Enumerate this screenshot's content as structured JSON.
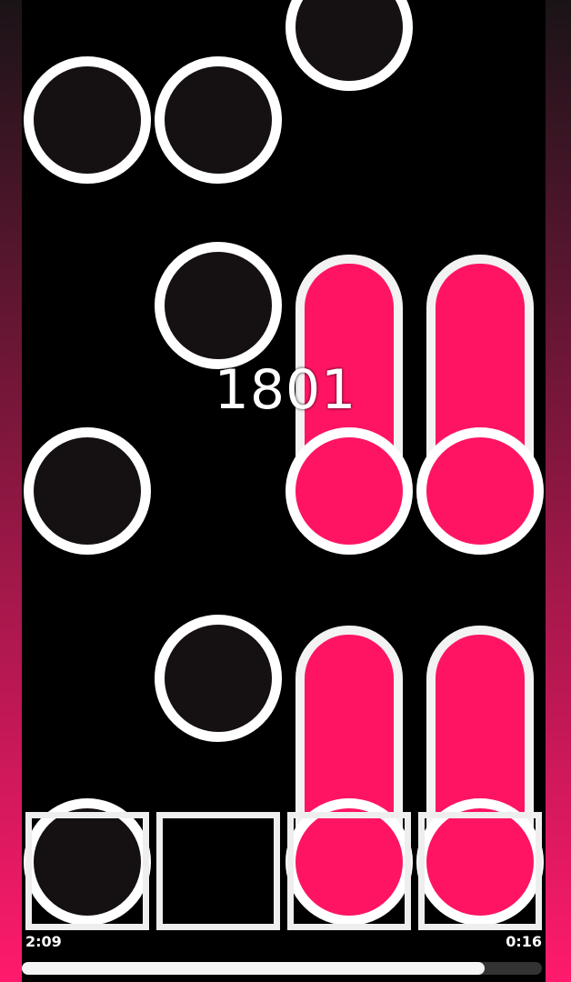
{
  "score": "1801",
  "time_elapsed": "2:09",
  "time_remaining": "0:16",
  "progress_fraction": 0.89,
  "lanes": 4,
  "colors": {
    "background": "#000000",
    "note_fill": "#151011",
    "note_ring": "#ffffff",
    "hold_fill": "#ff1464",
    "side_gradient_top": "#1a1417",
    "side_gradient_bottom": "#ff1a6c",
    "receptor_border": "#eeeeee",
    "progress_fill": "#f4f4f4",
    "progress_track": "#333333"
  },
  "icons": {
    "tap_note": "circle-note",
    "hold_note": "hold-note",
    "receptor": "square-receptor"
  }
}
